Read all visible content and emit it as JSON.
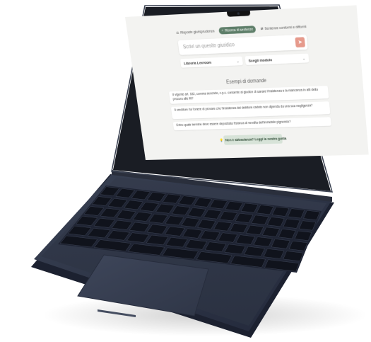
{
  "modes": [
    {
      "label": "Risposte giurisprudenza",
      "icon": "scale-icon",
      "active": false
    },
    {
      "label": "Ricerca di sentenze",
      "icon": "search-icon",
      "active": true
    },
    {
      "label": "Sentenze conformi e difformi",
      "icon": "compare-icon",
      "active": false
    }
  ],
  "search": {
    "placeholder": "Scrivi un quesito giuridico",
    "send_icon": "arrow-icon"
  },
  "selects": {
    "library": "Libreria Lexroom",
    "module": "Scegli modulo"
  },
  "examples": {
    "title": "Esempi di domande",
    "items": [
      "Il vigente art. 182, comma secondo, c.p.c. consente al giudice di sanare l'insistenza e la mancanza in atti della procura alle liti?",
      "Il creditore ha l'onere di provare che l'insistenza del debitore caduto non dipenda da una sua negligenza?",
      "Entro quale termine deve essere depositata l'istanza di vendita dell'immobile pignorato?"
    ]
  },
  "guide": {
    "label": "Non è abbastanza? Leggi la nostra guida",
    "icon": "bulb-icon"
  },
  "colors": {
    "accent": "#5f7f6a",
    "send": "#e69a8c",
    "guide_bg": "#d7e3d8",
    "laptop_body": "#2d3443"
  }
}
